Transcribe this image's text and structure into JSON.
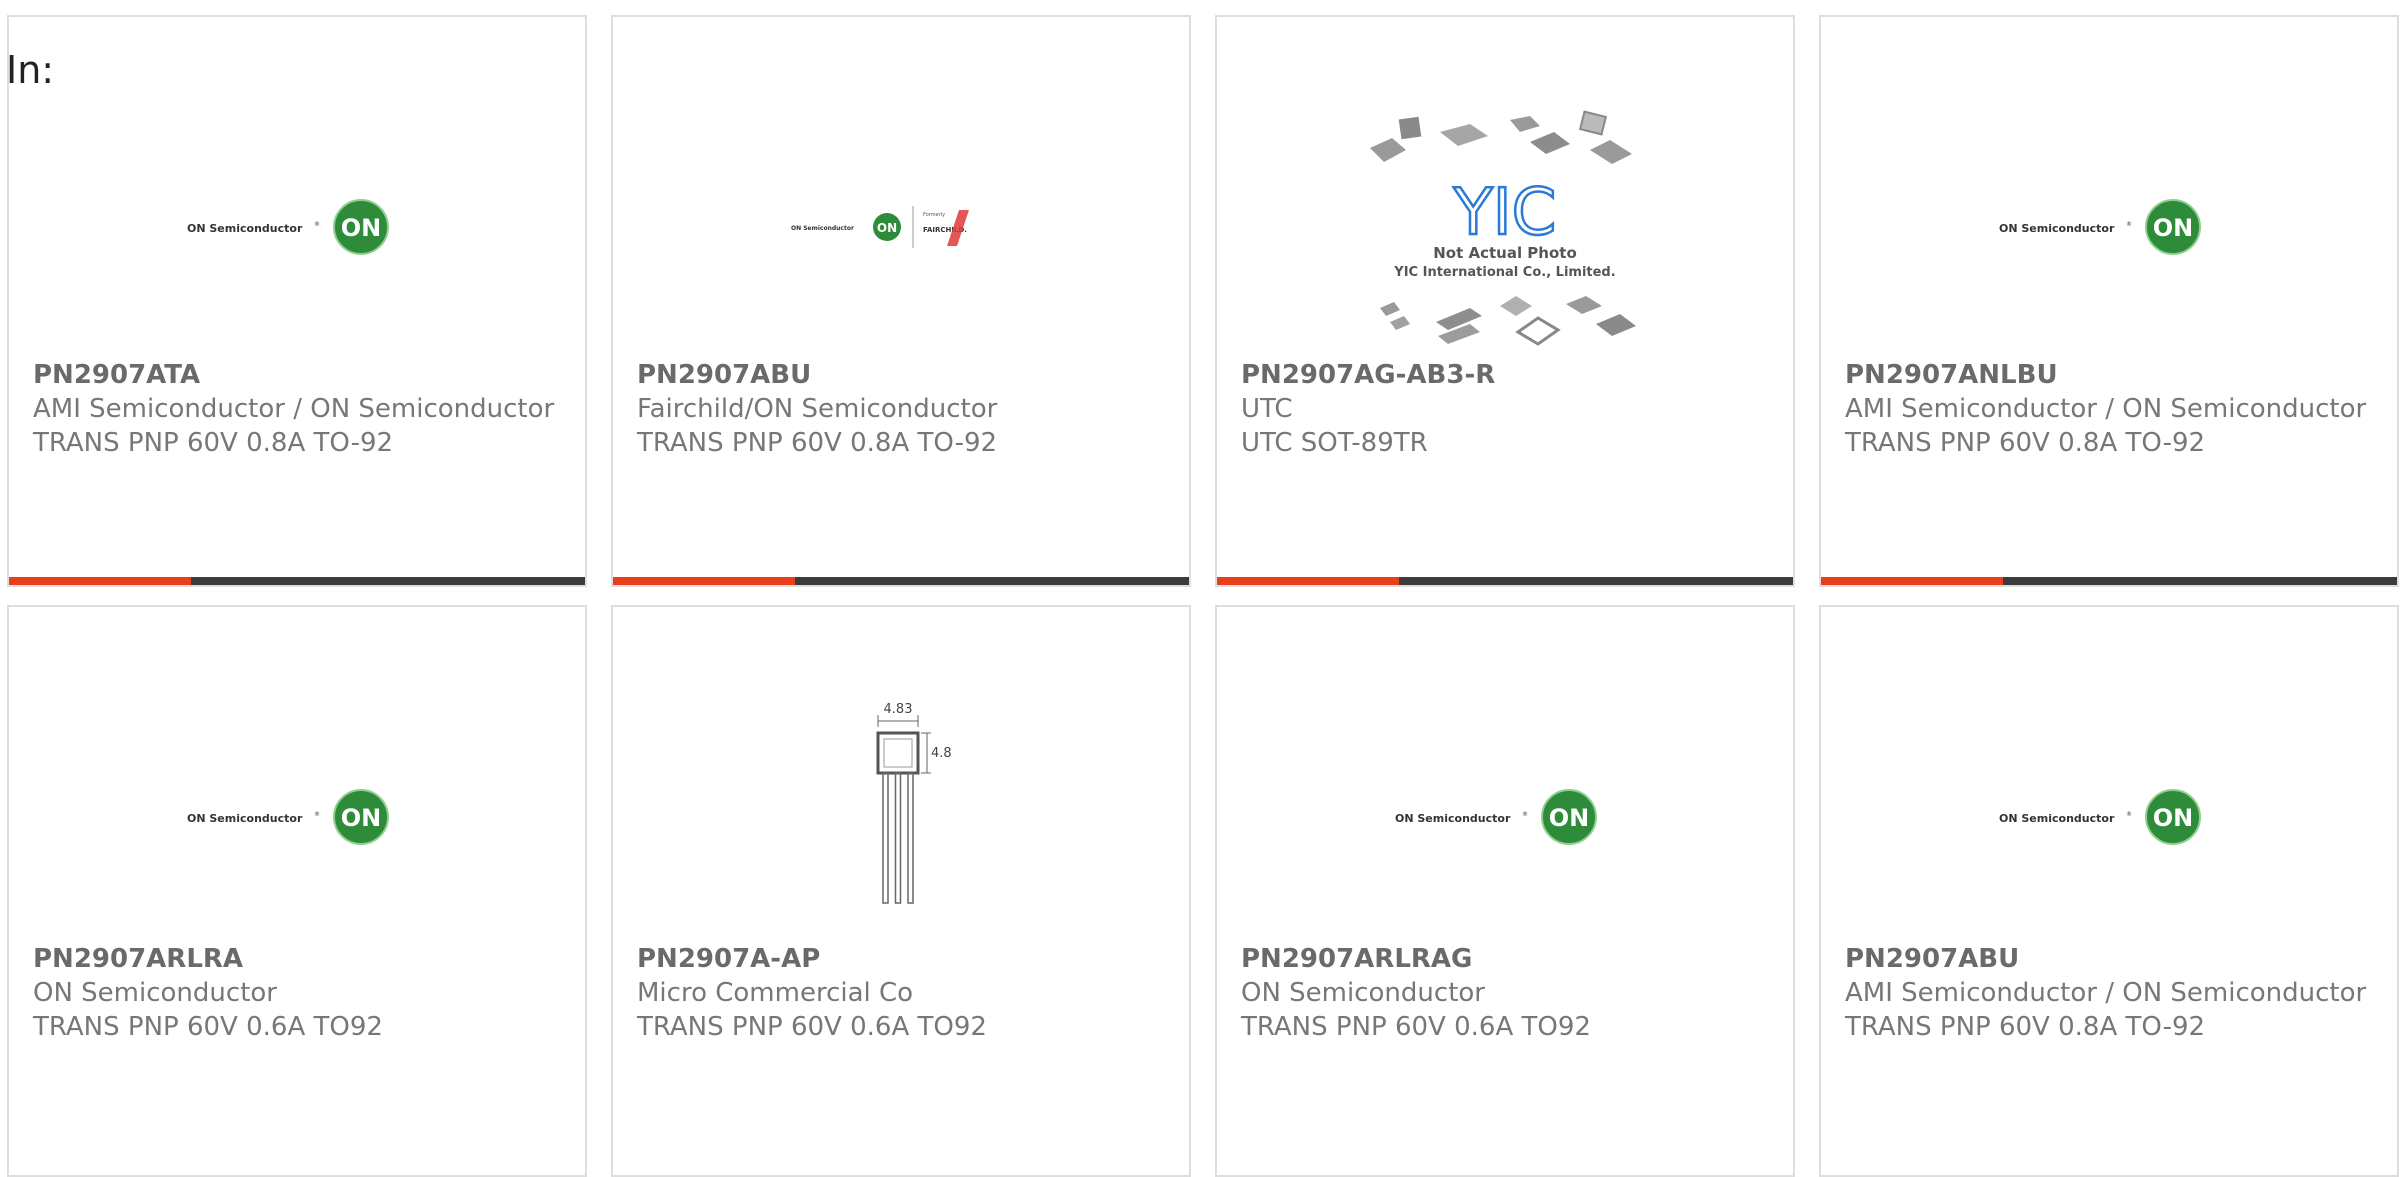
{
  "filter": {
    "label": "In:"
  },
  "colors": {
    "accent": "#e8401c",
    "bar": "#3c3c3c",
    "on_green": "#2e8b3a",
    "fairchild_red": "#e03a3a",
    "yic_blue": "#2a7ad6"
  },
  "products": [
    {
      "part_number": "PN2907ATA",
      "manufacturer": "AMI Semiconductor / ON Semiconductor",
      "description": "TRANS PNP 60V 0.8A TO-92",
      "image": "on-semiconductor-logo",
      "logo_text": "ON Semiconductor",
      "badge": "ON"
    },
    {
      "part_number": "PN2907ABU",
      "manufacturer": "Fairchild/ON Semiconductor",
      "description": "TRANS PNP 60V 0.8A TO-92",
      "image": "fairchild-on-logo",
      "logo_text": "ON Semiconductor",
      "badge": "ON",
      "formerly": "Formerly",
      "fairchild": "FAIRCHILD."
    },
    {
      "part_number": "PN2907AG-AB3-R",
      "manufacturer": "UTC",
      "description": "UTC SOT-89TR",
      "image": "yic-placeholder",
      "yic_mark": "YIC",
      "yic_line1": "Not Actual Photo",
      "yic_line2": "YIC International Co., Limited."
    },
    {
      "part_number": "PN2907ANLBU",
      "manufacturer": "AMI Semiconductor / ON Semiconductor",
      "description": "TRANS PNP 60V 0.8A TO-92",
      "image": "on-semiconductor-logo",
      "logo_text": "ON Semiconductor",
      "badge": "ON"
    },
    {
      "part_number": "PN2907ARLRA",
      "manufacturer": "ON Semiconductor",
      "description": "TRANS PNP 60V 0.6A TO92",
      "image": "on-semiconductor-logo",
      "logo_text": "ON Semiconductor",
      "badge": "ON"
    },
    {
      "part_number": "PN2907A-AP",
      "manufacturer": "Micro Commercial Co",
      "description": "TRANS PNP 60V 0.6A TO92",
      "image": "to92-package-drawing",
      "dim_width": "4.83",
      "dim_height": "4.83"
    },
    {
      "part_number": "PN2907ARLRAG",
      "manufacturer": "ON Semiconductor",
      "description": "TRANS PNP 60V 0.6A TO92",
      "image": "on-semiconductor-logo",
      "logo_text": "ON Semiconductor",
      "badge": "ON"
    },
    {
      "part_number": "PN2907ABU",
      "manufacturer": "AMI Semiconductor / ON Semiconductor",
      "description": "TRANS PNP 60V 0.8A TO-92",
      "image": "on-semiconductor-logo",
      "logo_text": "ON Semiconductor",
      "badge": "ON"
    }
  ]
}
